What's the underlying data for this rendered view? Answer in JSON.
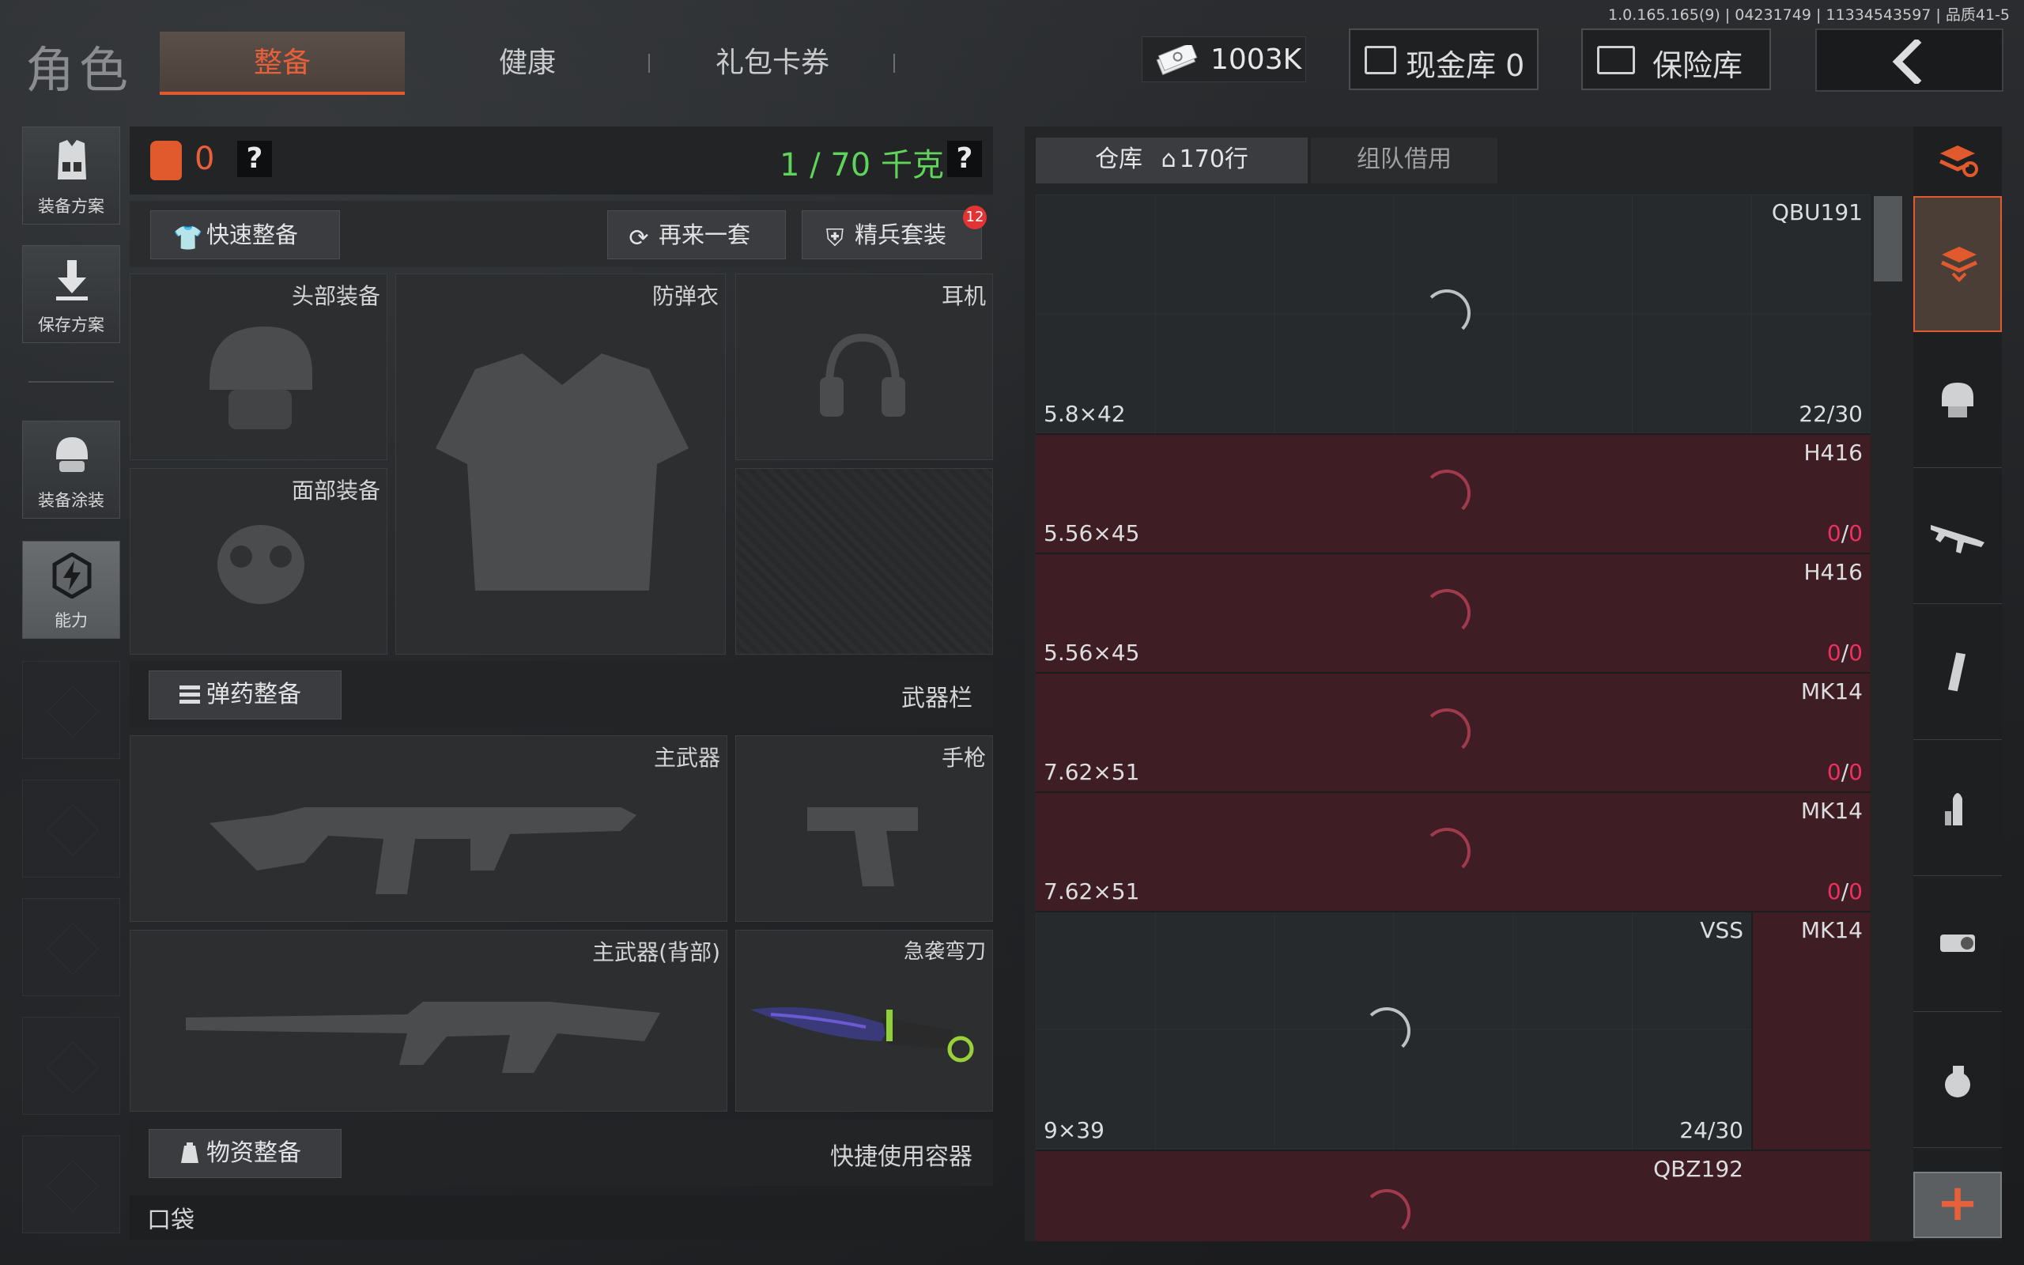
{
  "build_info": "1.0.165.165(9) | 04231749 | 11334543597 | 品质41-5",
  "header": {
    "role_title": "角色",
    "tabs": [
      {
        "label": "整备",
        "active": true
      },
      {
        "label": "健康",
        "active": false
      },
      {
        "label": "礼包卡券",
        "active": false
      }
    ],
    "cash": "1003K",
    "cash_vault": "现金库 0",
    "safe_vault": "保险库",
    "back_icon": "chevron-left-icon"
  },
  "sidebar": {
    "items": [
      {
        "label": "装备方案",
        "icon": "vest-plan-icon"
      },
      {
        "label": "保存方案",
        "icon": "download-arrow-icon"
      },
      {
        "label": "装备涂装",
        "icon": "helmet-paint-icon"
      },
      {
        "label": "能力",
        "icon": "lightning-hex-icon",
        "active": true
      }
    ]
  },
  "loadout": {
    "bag_count": "0",
    "help": "?",
    "weight": "1 / 70 千克",
    "quick_equip": "快速整备",
    "again_set": "再来一套",
    "elite_set": "精兵套装",
    "elite_badge": "12",
    "slots": {
      "head": "头部装备",
      "armor": "防弹衣",
      "headset": "耳机",
      "face": "面部装备",
      "primary": "主武器",
      "pistol": "手枪",
      "primary_back": "主武器(背部)",
      "melee": "急袭弯刀"
    },
    "ammo_section": "弹药整备",
    "weapon_bar": "武器栏",
    "supply_section": "物资整备",
    "quick_container": "快捷使用容器",
    "pocket": "口袋"
  },
  "warehouse": {
    "tab_active": "仓库",
    "rows": "170行",
    "tab_team": "组队借用",
    "items": [
      {
        "name": "QBU191",
        "caliber": "5.8×42",
        "ammo_cur": "22",
        "ammo_max": "30",
        "status": "ok"
      },
      {
        "name": "H416",
        "caliber": "5.56×45",
        "ammo_cur": "0",
        "ammo_max": "0",
        "status": "bad"
      },
      {
        "name": "H416",
        "caliber": "5.56×45",
        "ammo_cur": "0",
        "ammo_max": "0",
        "status": "bad"
      },
      {
        "name": "MK14",
        "caliber": "7.62×51",
        "ammo_cur": "0",
        "ammo_max": "0",
        "status": "bad"
      },
      {
        "name": "MK14",
        "caliber": "7.62×51",
        "ammo_cur": "0",
        "ammo_max": "0",
        "status": "bad"
      },
      {
        "name": "VSS",
        "caliber": "9×39",
        "ammo_cur": "24",
        "ammo_max": "30",
        "status": "ok"
      },
      {
        "name": "MK14",
        "caliber": "",
        "ammo_cur": "",
        "ammo_max": "",
        "status": "bad"
      },
      {
        "name": "QBZ192",
        "caliber": "",
        "ammo_cur": "",
        "ammo_max": "",
        "status": "bad"
      }
    ]
  },
  "filters": [
    {
      "icon": "stack-refresh-icon"
    },
    {
      "icon": "stack-down-icon",
      "active": true
    },
    {
      "icon": "armor-icon"
    },
    {
      "icon": "rifle-icon"
    },
    {
      "icon": "magazine-icon"
    },
    {
      "icon": "bullet-icon"
    },
    {
      "icon": "scope-icon"
    },
    {
      "icon": "grenade-icon"
    },
    {
      "icon": "add-icon",
      "label": "+"
    }
  ],
  "colors": {
    "accent": "#e05a2e",
    "weight_green": "#5fd35a",
    "invalid_row": "#3e1d25",
    "ammo_zero": "#ef2f5e"
  }
}
